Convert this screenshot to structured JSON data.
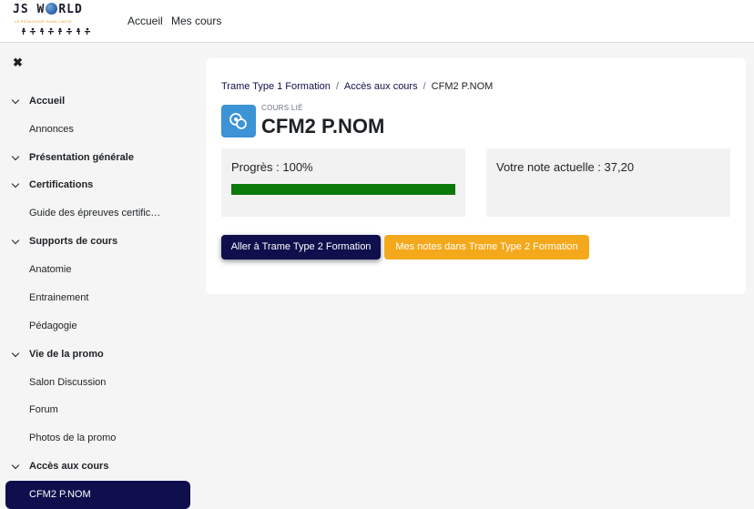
{
  "brand": {
    "logo_text_left": "JS W",
    "logo_text_right": "RLD",
    "logo_tagline": "LA PÉDAGOGIE SANS LIMITE"
  },
  "nav": {
    "items": [
      {
        "label": "Accueil"
      },
      {
        "label": "Mes cours"
      }
    ]
  },
  "sidebar": {
    "close_glyph": "✖",
    "items": [
      {
        "label": "Accueil",
        "type": "section"
      },
      {
        "label": "Annonces",
        "type": "link"
      },
      {
        "label": "Présentation générale",
        "type": "section"
      },
      {
        "label": "Certifications",
        "type": "section"
      },
      {
        "label": "Guide des épreuves certific…",
        "type": "link"
      },
      {
        "label": "Supports de cours",
        "type": "section"
      },
      {
        "label": "Anatomie",
        "type": "link"
      },
      {
        "label": "Entrainement",
        "type": "link"
      },
      {
        "label": "Pédagogie",
        "type": "link"
      },
      {
        "label": "Vie de la promo",
        "type": "section"
      },
      {
        "label": "Salon Discussion",
        "type": "link"
      },
      {
        "label": "Forum",
        "type": "link"
      },
      {
        "label": "Photos de la promo",
        "type": "link"
      },
      {
        "label": "Accès aux cours",
        "type": "section"
      },
      {
        "label": "CFM2 P.NOM",
        "type": "active"
      }
    ]
  },
  "breadcrumb": {
    "items": [
      "Trame Type 1 Formation",
      "Accès aux cours",
      "CFM2 P.NOM"
    ],
    "separator": "/"
  },
  "course": {
    "subtitle": "COURS LIÉ",
    "title": "CFM2 P.NOM",
    "icon": "linked-course-icon"
  },
  "progress": {
    "label": "Progrès : 100%",
    "value": 1.0
  },
  "grade": {
    "label": "Votre note actuelle : 37,20"
  },
  "buttons": {
    "go_label": "Aller à Trame Type 2 Formation",
    "grades_label": "Mes notes dans Trame Type 2 Formation"
  },
  "colors": {
    "primary": "#0f0f4d",
    "warning": "#f4a91c",
    "progress": "#0b7a0b",
    "course_icon_bg": "#3c93d6"
  }
}
